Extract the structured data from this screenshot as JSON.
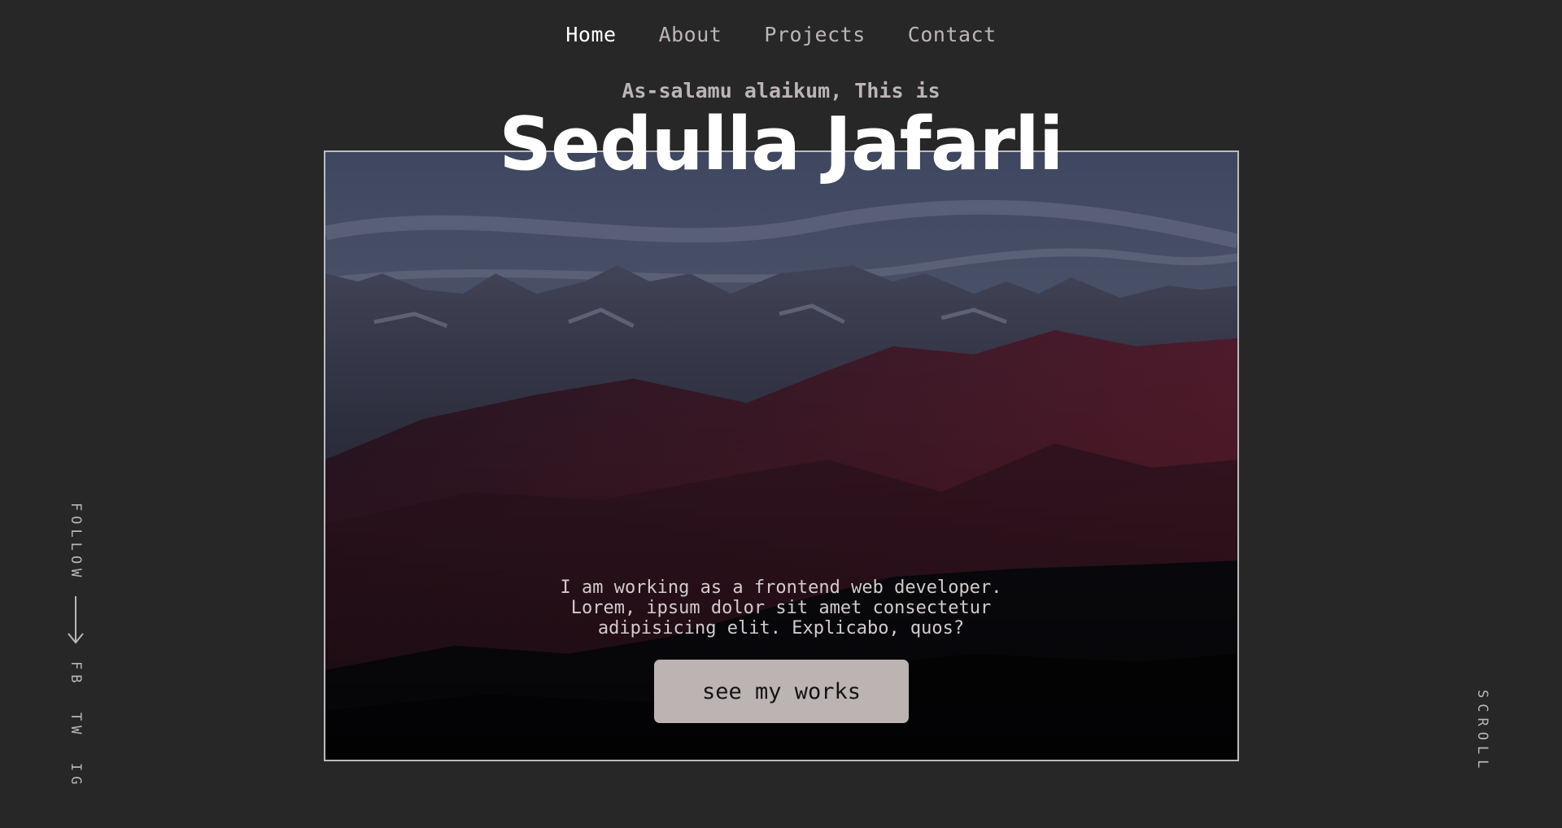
{
  "nav": {
    "items": [
      {
        "label": "Home",
        "active": true
      },
      {
        "label": "About",
        "active": false
      },
      {
        "label": "Projects",
        "active": false
      },
      {
        "label": "Contact",
        "active": false
      }
    ]
  },
  "hero": {
    "greeting": "As-salamu alaikum, This is",
    "name": "Sedulla Jafarli",
    "about_lines": [
      "I am working as a frontend web developer.",
      "Lorem, ipsum dolor sit amet consectetur",
      "adipisicing elit. Explicabo, quos?"
    ],
    "cta_label": "see my works",
    "image_icon": "mountain-landscape-image"
  },
  "social": {
    "follow_label": "FOLLOW",
    "arrow_icon": "arrow-down-icon",
    "links": [
      "FB",
      "TW",
      "IG"
    ]
  },
  "scroll_label": "SCROLL",
  "colors": {
    "background": "#272727",
    "text": "#bdb5b5",
    "active": "#ffffff",
    "button": "#bcb3b3",
    "frame_border": "#bcbcbc"
  }
}
